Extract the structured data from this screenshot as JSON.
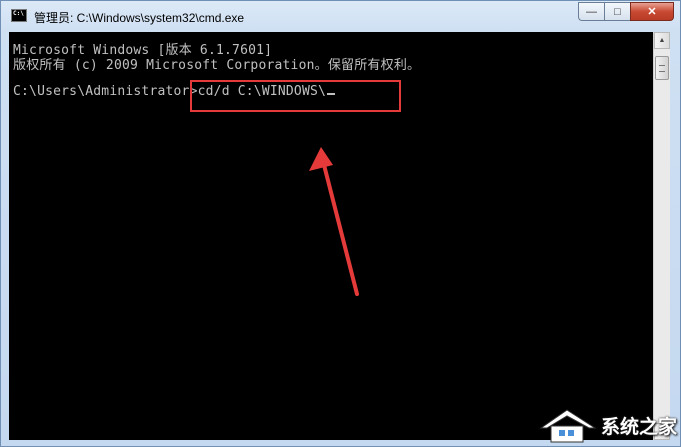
{
  "window": {
    "title": "管理员: C:\\Windows\\system32\\cmd.exe",
    "icon_text": "C:\\",
    "minimize_label": "—",
    "maximize_label": "□",
    "close_label": "✕"
  },
  "console": {
    "lines": [
      "Microsoft Windows [版本 6.1.7601]",
      "版权所有 (c) 2009 Microsoft Corporation。保留所有权利。",
      "",
      "C:\\Users\\Administrator>cd/d C:\\WINDOWS\\"
    ],
    "text_color": "#c0c0c0",
    "background": "#000000"
  },
  "annotation": {
    "color": "#e53a3a"
  },
  "watermark": {
    "text": "系统之家"
  }
}
